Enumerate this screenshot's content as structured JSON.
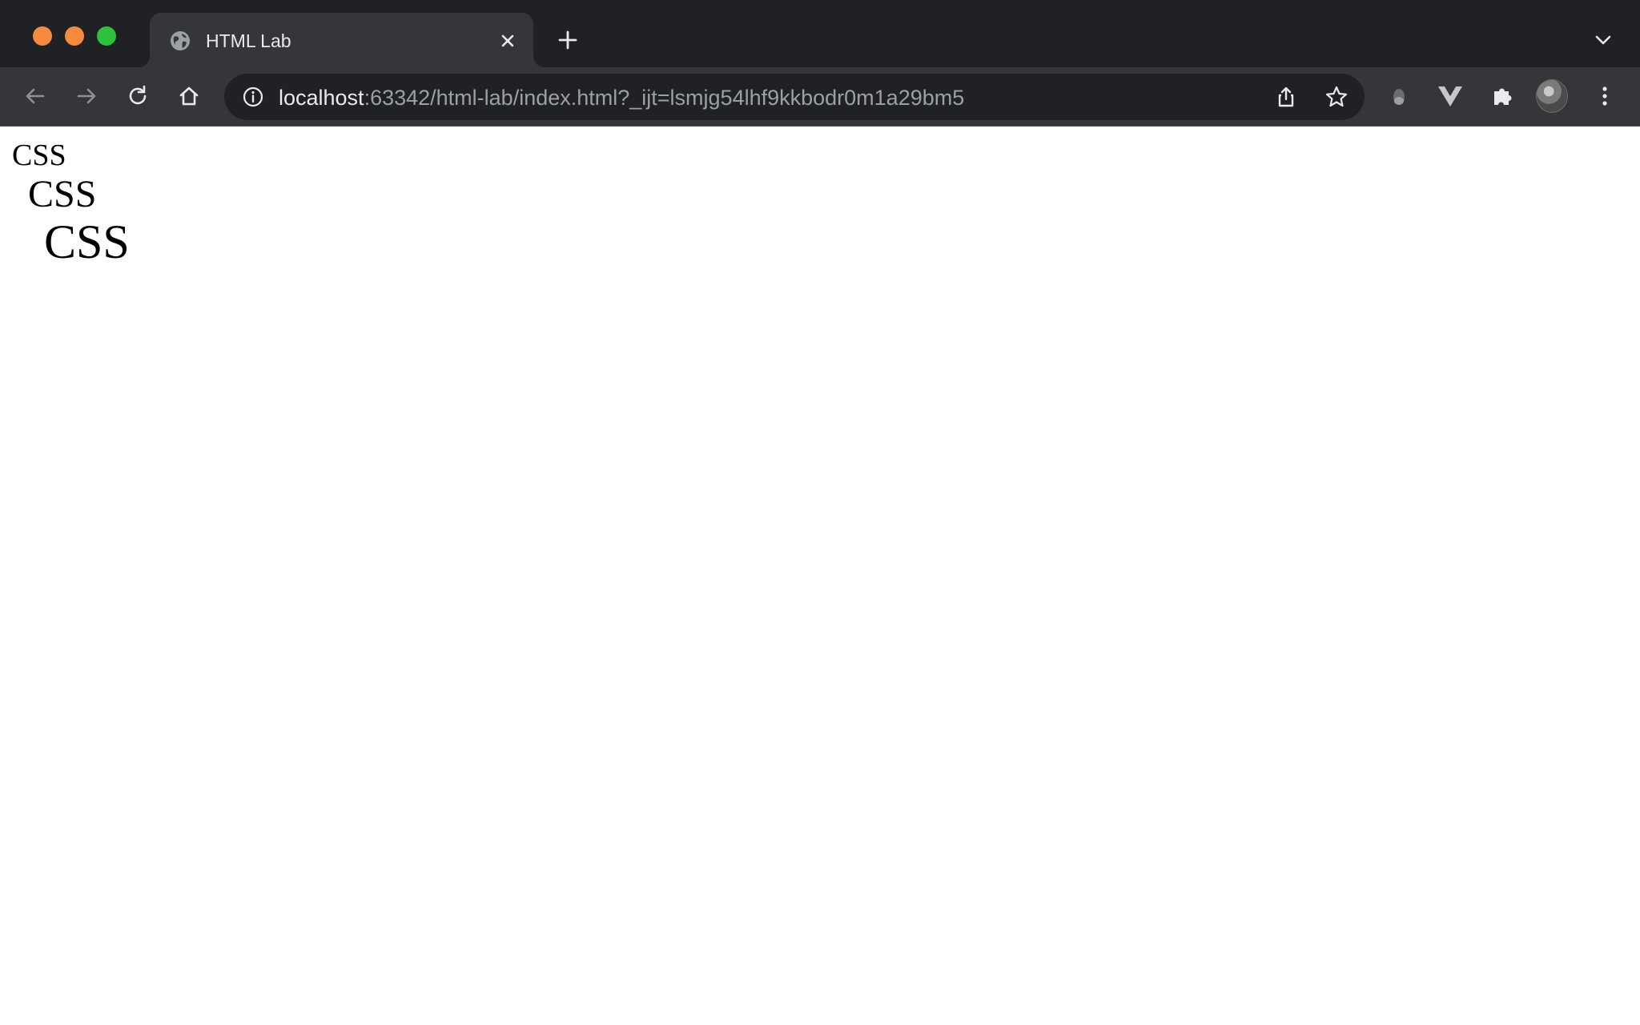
{
  "window": {
    "traffic_lights": {
      "close_color": "#f68a3f",
      "minimize_color": "#f68a3f",
      "zoom_color": "#2cc23e"
    }
  },
  "tabs": [
    {
      "title": "HTML Lab",
      "favicon": "globe-icon",
      "active": true
    }
  ],
  "toolbar": {
    "back_icon": "arrow-left-icon",
    "forward_icon": "arrow-right-icon",
    "reload_icon": "reload-icon",
    "home_icon": "home-icon"
  },
  "omnibox": {
    "url_host": "localhost",
    "url_rest": ":63342/html-lab/index.html?_ijt=lsmjg54lhf9kkbodr0m1a29bm5",
    "info_icon": "info-icon",
    "share_icon": "share-icon",
    "bookmark_icon": "star-icon"
  },
  "extensions": [
    {
      "name": "extension-icon"
    },
    {
      "name": "vue-devtools-icon"
    },
    {
      "name": "puzzle-icon"
    }
  ],
  "page": {
    "lines": [
      "CSS",
      "CSS",
      "CSS"
    ]
  },
  "colors": {
    "tabstrip_bg": "#202124",
    "toolbar_bg": "#35363a",
    "page_bg": "#ffffff",
    "text": "#000000"
  }
}
